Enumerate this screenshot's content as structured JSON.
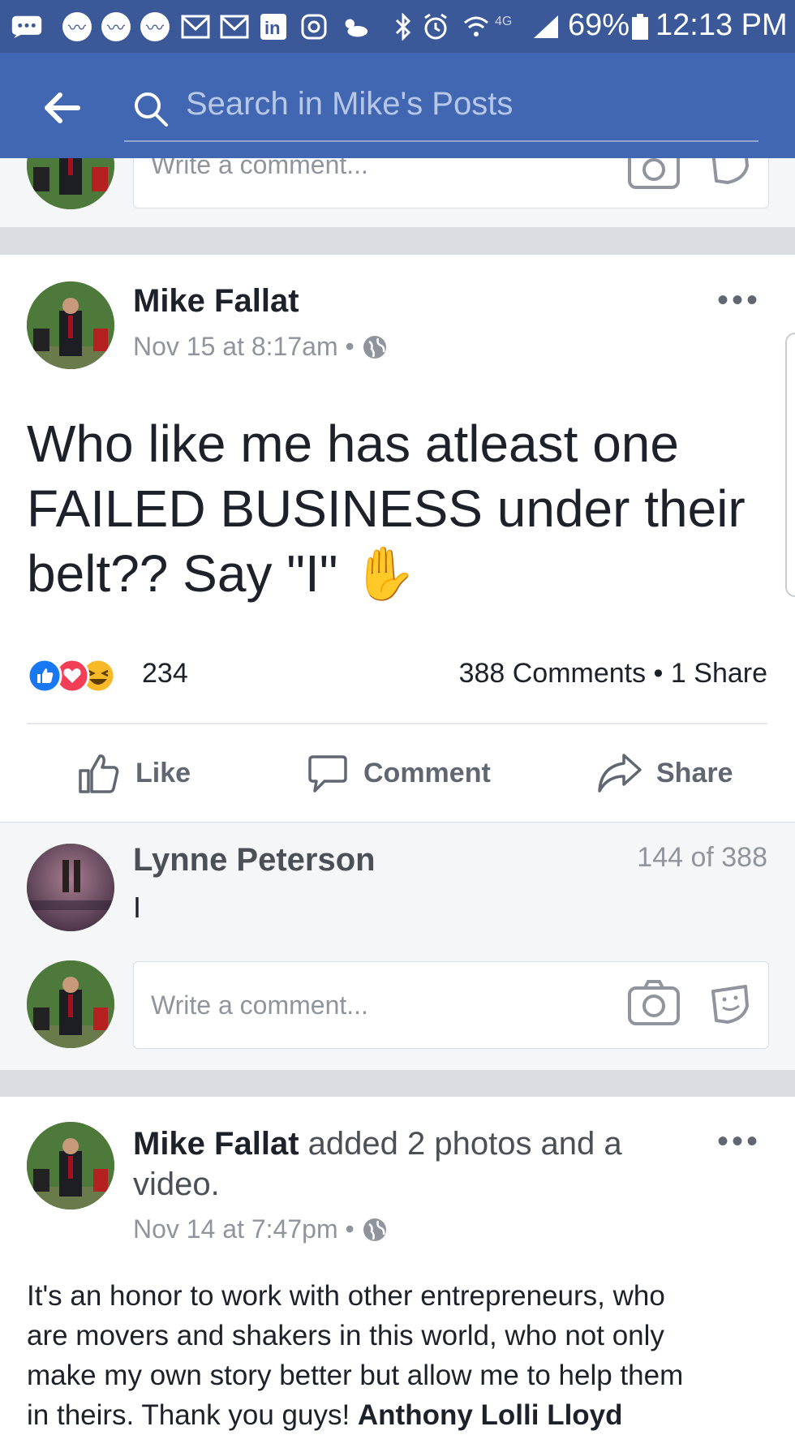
{
  "status_bar": {
    "battery_percent": "69%",
    "time": "12:13 PM",
    "network": "4G",
    "icons": [
      "messages-icon",
      "messenger-icon",
      "messenger-icon",
      "messenger-icon",
      "gmail-icon",
      "gmail-icon",
      "linkedin-icon",
      "instagram-icon",
      "weather-icon",
      "bluetooth-icon",
      "alarm-icon",
      "wifi-icon",
      "signal-icon",
      "battery-icon"
    ]
  },
  "header": {
    "search_placeholder": "Search in Mike's Posts"
  },
  "top_comment_box": {
    "placeholder": "Write a comment..."
  },
  "post1": {
    "author": "Mike Fallat",
    "timestamp": "Nov 15 at 8:17am",
    "text_lines": [
      "Who like me has atleast one",
      "FAILED BUSINESS under their",
      "belt??  Say \"I\""
    ],
    "emoji": "✋",
    "reaction_count": "234",
    "comments_shares": "388 Comments • 1 Share",
    "actions": {
      "like": "Like",
      "comment": "Comment",
      "share": "Share"
    }
  },
  "comment": {
    "author": "Lynne Peterson",
    "text": "I",
    "position": "144 of 388"
  },
  "comment_box": {
    "placeholder": "Write a comment..."
  },
  "post2": {
    "author": "Mike Fallat",
    "action_text": "added 2 photos and a",
    "action_text_2": "video.",
    "timestamp": "Nov 14 at 7:47pm",
    "text_lines": [
      "It's an honor to work with other entrepreneurs, who",
      "are movers and shakers in this world, who not only",
      "make my own story better but allow me to help them"
    ],
    "text_partial": "in theirs. Thank you guys! ",
    "mention_partial": "Anthony Lolli Lloyd"
  },
  "colors": {
    "brand_blue": "#4267b2",
    "status_blue": "#3b5998",
    "like_blue": "#1877f2",
    "love_red": "#f33e58",
    "haha_yellow": "#f7b928"
  }
}
